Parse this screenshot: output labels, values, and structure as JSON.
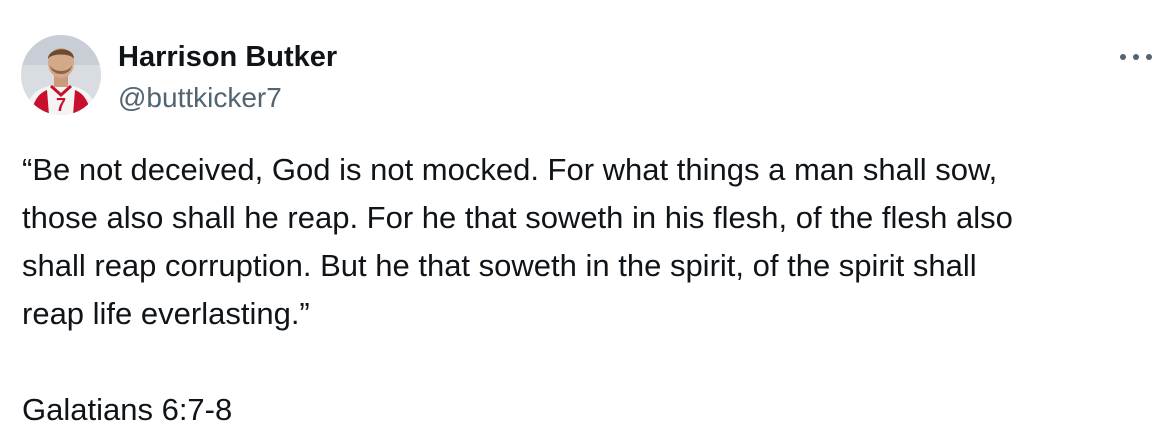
{
  "author": {
    "name": "Harrison Butker",
    "handle": "@buttkicker7",
    "avatar_icon": "player-portrait-avatar",
    "jersey_number": "7"
  },
  "header": {
    "more_icon": "more-options-icon"
  },
  "tweet": {
    "lines": [
      "“Be not deceived, God is not mocked. For what things a man shall sow,",
      "those also shall he reap. For he that soweth in his flesh, of the flesh also",
      "shall reap corruption. But he that soweth in the spirit, of the spirit shall",
      "reap life everlasting.”"
    ],
    "reference": "Galatians 6:7-8"
  },
  "colors": {
    "text_primary": "#0f1419",
    "text_secondary": "#536471",
    "background": "#ffffff",
    "jersey_red": "#c8102e"
  }
}
